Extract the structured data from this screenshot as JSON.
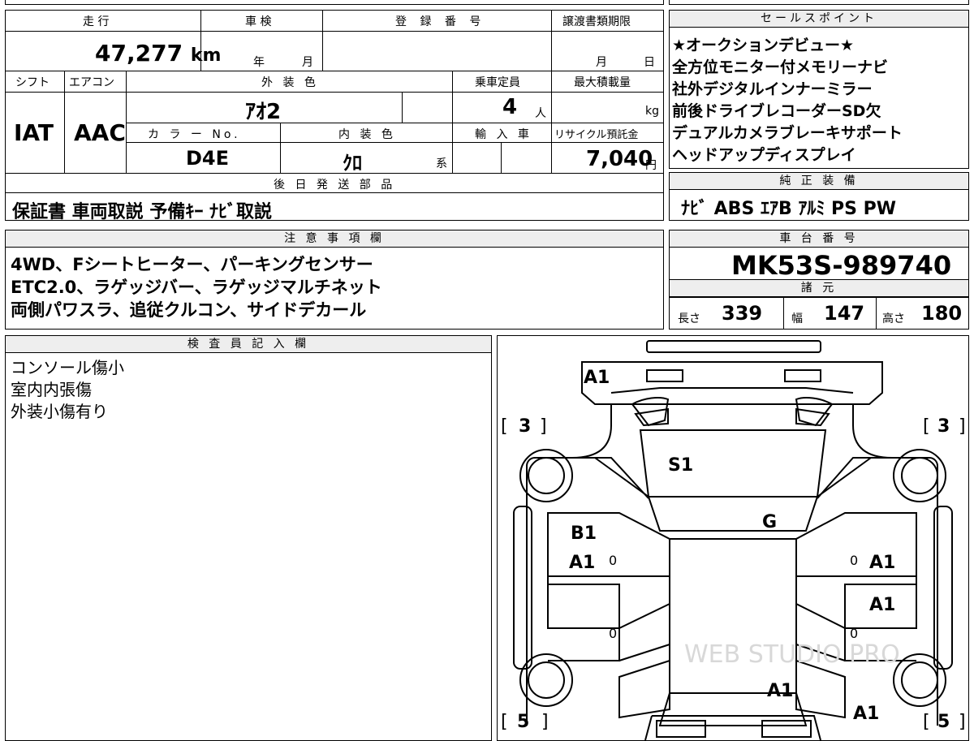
{
  "top_row": {
    "mileage_label": "走 行",
    "mileage_value": "47,277",
    "mileage_unit": "km",
    "inspection_label": "車 検",
    "inspection_year": "年",
    "inspection_month": "月",
    "regno_label": "登 録 番 号",
    "transfer_label": "譲渡書類期限",
    "transfer_month": "月",
    "transfer_day": "日"
  },
  "row2": {
    "shift_label": "シフト",
    "shift_value": "IAT",
    "ac_label": "エアコン",
    "ac_value": "AAC",
    "ext_color_label": "外 装 色",
    "ext_color_value": "ｱｵ2",
    "capacity_label": "乗車定員",
    "capacity_value": "4",
    "capacity_unit": "人",
    "maxload_label": "最大積載量",
    "maxload_unit": "kg",
    "color_no_label": "カ ラ ー No.",
    "color_no_value": "D4E",
    "int_color_label": "内 装 色",
    "int_color_value": "ｸﾛ",
    "int_color_suffix": "系",
    "import_label": "輸 入 車",
    "recycle_label": "リサイクル預託金",
    "recycle_value": "7,040",
    "recycle_unit": "円"
  },
  "later_parts": {
    "label": "後 日 発 送 部 品",
    "value": "保証書 車両取説 予備ｷｰ ﾅﾋﾞ取説"
  },
  "sales_points": {
    "label": "セールスポイント",
    "lines": [
      "★オークションデビュー★",
      "全方位モニター付メモリーナビ",
      "社外デジタルインナーミラー",
      "前後ドライブレコーダーSD欠",
      "デュアルカメラブレーキサポート",
      "ヘッドアップディスプレイ"
    ]
  },
  "genuine_equipment": {
    "label": "純 正 装 備",
    "value": "ﾅﾋﾞ ABS ｴｱB ｱﾙﾐ PS PW"
  },
  "notes": {
    "label": "注 意 事 項 欄",
    "lines": [
      "4WD、Fシートヒーター、パーキングセンサー",
      "ETC2.0、ラゲッジバー、ラゲッジマルチネット",
      "両側パワスラ、追従クルコン、サイドデカール"
    ]
  },
  "chassis": {
    "label": "車 台 番 号",
    "value": "MK53S-989740",
    "spec_label": "諸 元",
    "length_label": "長さ",
    "length_value": "339",
    "width_label": "幅",
    "width_value": "147",
    "height_label": "高さ",
    "height_value": "180"
  },
  "inspector": {
    "label": "検 査 員 記 入 欄",
    "lines": [
      "コンソール傷小",
      "室内内張傷",
      "外装小傷有り"
    ]
  },
  "diagram": {
    "marks": {
      "front_bumper": "A1",
      "windshield": "S1",
      "hood_glass": "G",
      "left_front_door_1": "B1",
      "left_front_door_2": "A1",
      "right_front_door": "A1",
      "right_rear_door": "A1",
      "rear_center": "A1",
      "rear_right": "A1",
      "tire_fl": "3",
      "tire_fr": "3",
      "tire_rl": "5",
      "tire_rr": "5",
      "door_zero": "0"
    },
    "watermark": "WEB STUDIO PRO"
  }
}
